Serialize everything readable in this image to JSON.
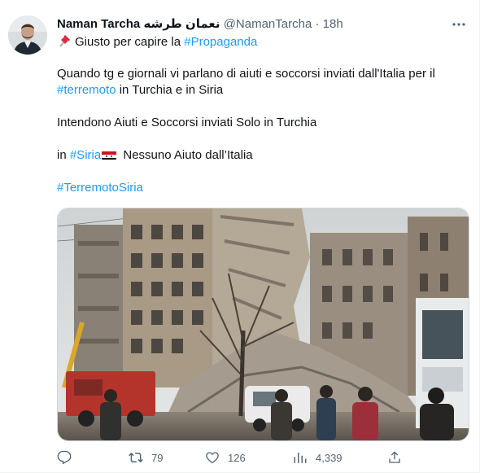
{
  "tweet": {
    "author_name": "Naman Tarcha نعمان طرشه",
    "handle": "@NamanTarcha",
    "separator": "·",
    "time": "18h",
    "line1_prefix": "Giusto per capire la ",
    "line1_hashtag": "#Propaganda",
    "p1_a": "Quando tg e giornali vi parlano di aiuti e soccorsi inviati dall'Italia per il",
    "p1_hashtag": "#terremoto",
    "p1_b": " in Turchia e in Siria",
    "p2": "Intendono Aiuti e Soccorsi inviati Solo in Turchia",
    "p3_prefix": "in ",
    "p3_hashtag": "#Siria",
    "p3_suffix": " Nessuno Aiuto dall’Italia",
    "p4_hashtag": "#TerremotoSiria"
  },
  "icons": {
    "pin": "pushpin-icon",
    "flag": "syria-flag-icon",
    "more": "more-icon",
    "reply": "reply-icon",
    "retweet": "retweet-icon",
    "like": "heart-icon",
    "views": "views-icon",
    "share": "share-icon"
  },
  "actions": {
    "retweets": "79",
    "likes": "126",
    "views": "4,339"
  },
  "colors": {
    "link": "#1d9bf0",
    "secondary": "#536471",
    "text": "#0f1419"
  }
}
